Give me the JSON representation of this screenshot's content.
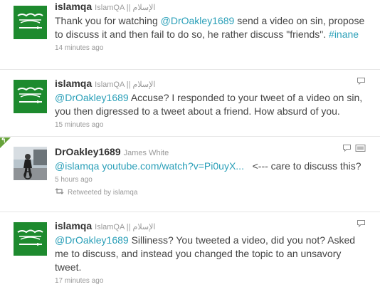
{
  "tweets": [
    {
      "screen_name": "islamqa",
      "full_name": "IslamQA || الإسلام",
      "avatar_icon": "green-flag-avatar-icon",
      "text_parts": [
        {
          "t": "Thank you for watching ",
          "kind": "text"
        },
        {
          "t": "@DrOakley1689",
          "kind": "mention"
        },
        {
          "t": " send a video on sin, propose to discuss it and then fail to do so, he rather discuss \"friends\". ",
          "kind": "text"
        },
        {
          "t": "#inane",
          "kind": "mention"
        }
      ],
      "timestamp": "14 minutes ago"
    },
    {
      "screen_name": "islamqa",
      "full_name": "IslamQA || الإسلام",
      "avatar_icon": "green-flag-avatar-icon",
      "text_parts": [
        {
          "t": "@DrOakley1689",
          "kind": "mention"
        },
        {
          "t": " Accuse? I responded to your tweet of a video on sin, you then digressed to a tweet about a friend. How absurd of you.",
          "kind": "text"
        }
      ],
      "timestamp": "15 minutes ago",
      "actions": [
        "reply-icon"
      ]
    },
    {
      "screen_name": "DrOakley1689",
      "full_name": "James White",
      "avatar_icon": "cyclist-photo-avatar-icon",
      "text_parts": [
        {
          "t": "@islamqa",
          "kind": "mention"
        },
        {
          "t": " ",
          "kind": "text"
        },
        {
          "t": "youtube.com/watch?v=Pi0uyX...",
          "kind": "link"
        },
        {
          "t": "   <--- care to discuss this?",
          "kind": "text"
        }
      ],
      "timestamp": "5 hours ago",
      "retweeted_by": "Retweeted by islamqa",
      "actions": [
        "reply-icon",
        "media-icon"
      ]
    },
    {
      "screen_name": "islamqa",
      "full_name": "IslamQA || الإسلام",
      "avatar_icon": "green-flag-avatar-icon",
      "text_parts": [
        {
          "t": "@DrOakley1689",
          "kind": "mention"
        },
        {
          "t": " Silliness? You tweeted a video, did you not? Asked me to discuss, and instead you changed the topic to an unsavory tweet.",
          "kind": "text"
        }
      ],
      "timestamp": "17 minutes ago",
      "actions": [
        "reply-icon"
      ]
    }
  ],
  "colors": {
    "link": "#2a9fb8",
    "flag_green": "#1d8a2e",
    "retweet_corner": "#66a23a"
  }
}
